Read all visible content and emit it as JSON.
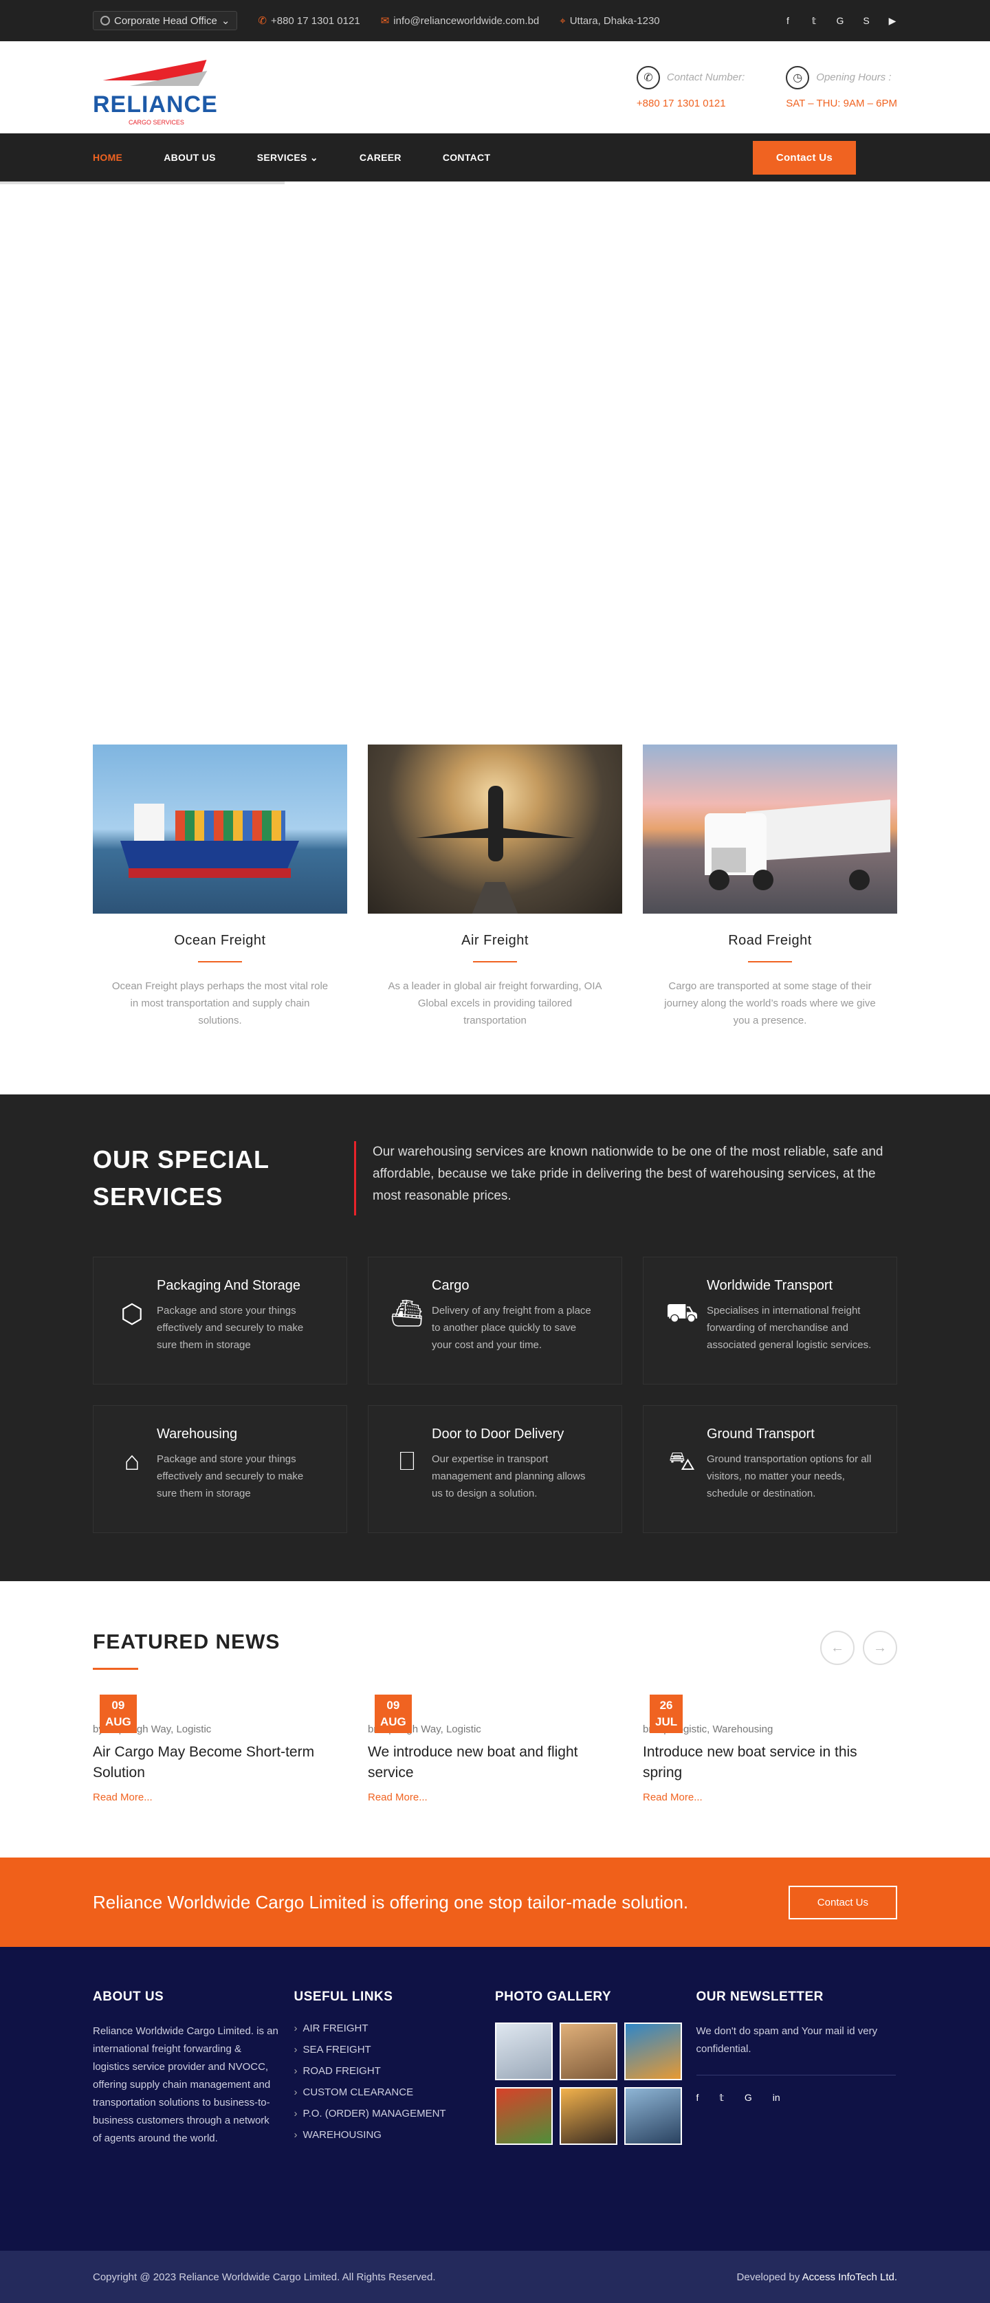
{
  "topbar": {
    "office": "Corporate Head Office",
    "phone": "+880 17 1301 0121",
    "email": "info@relianceworldwide.com.bd",
    "location": "Uttara, Dhaka-1230",
    "social_icons": [
      "facebook-icon",
      "twitter-icon",
      "google-plus-icon",
      "skype-icon",
      "youtube-icon"
    ]
  },
  "header": {
    "logo_text": "RELIANCE",
    "logo_sub": "CARGO SERVICES",
    "contact_label": "Contact Number:",
    "contact_value": "+880 17 1301 0121",
    "hours_label": "Opening Hours :",
    "hours_value": "SAT – THU: 9AM – 6PM"
  },
  "nav": {
    "items": [
      "HOME",
      "ABOUT US",
      "SERVICES",
      "CAREER",
      "CONTACT"
    ],
    "cta": "Contact Us"
  },
  "features": [
    {
      "title": "Ocean Freight",
      "text": "Ocean Freight plays perhaps the most vital role in most transportation and supply chain solutions."
    },
    {
      "title": "Air Freight",
      "text": "As a leader in global air freight forwarding, OIA Global excels in providing tailored transportation"
    },
    {
      "title": "Road Freight",
      "text": "Cargo are transported at some stage of their journey along the world’s roads where we give you a presence."
    }
  ],
  "special": {
    "title": "OUR SPECIAL SERVICES",
    "desc": "Our warehousing services are known nationwide to be one of the most reliable, safe and affordable, because we take pride in delivering the best of warehousing services, at the most reasonable prices.",
    "items": [
      {
        "title": "Packaging And Storage",
        "text": "Package and store your things effectively and securely to make sure them in storage"
      },
      {
        "title": "Cargo",
        "text": "Delivery of any freight from a place to another place quickly to save your cost and your time."
      },
      {
        "title": "Worldwide Transport",
        "text": "Specialises in international freight forwarding of merchandise and associated general logistic services."
      },
      {
        "title": "Warehousing",
        "text": "Package and store your things effectively and securely to make sure them in storage"
      },
      {
        "title": "Door to Door Delivery",
        "text": "Our expertise in transport management and planning allows us to design a solution."
      },
      {
        "title": "Ground Transport",
        "text": "Ground transportation options for all visitors, no matter your needs, schedule or destination."
      }
    ]
  },
  "news": {
    "title": "FEATURED NEWS",
    "items": [
      {
        "day": "09",
        "month": "AUG",
        "meta_by": "by",
        "meta_cat": "High Way, Logistic",
        "meta_author": "re",
        "title": "Air Cargo May Become Short-term Solution",
        "more": "Read More..."
      },
      {
        "day": "09",
        "month": "AUG",
        "meta_by": "b",
        "meta_cat": "High Way, Logistic",
        "meta_author": "re",
        "title": "We introduce new boat and flight service",
        "more": "Read More..."
      },
      {
        "day": "26",
        "month": "JUL",
        "meta_by": "b",
        "meta_cat": "Logistic, Warehousing",
        "meta_author": "re",
        "title": "Introduce new boat service in this spring",
        "more": "Read More..."
      }
    ]
  },
  "band": {
    "text": "Reliance Worldwide Cargo Limited is offering one stop tailor-made solution.",
    "button": "Contact Us"
  },
  "footer": {
    "about_title": "ABOUT US",
    "about_text": "Reliance Worldwide Cargo Limited. is an international freight forwarding & logistics service provider and NVOCC, offering supply chain management and transportation solutions to business-to-business customers through a network of agents around the world.",
    "links_title": "USEFUL LINKS",
    "links": [
      "AIR FREIGHT",
      "SEA FREIGHT",
      "ROAD FREIGHT",
      "CUSTOM CLEARANCE",
      "P.O. (ORDER) MANAGEMENT",
      "WAREHOUSING"
    ],
    "gallery_title": "PHOTO GALLERY",
    "newsletter_title": "OUR NEWSLETTER",
    "newsletter_text": "We don't do spam and Your mail id very confidential.",
    "copyright": "Copyright @ 2023 Reliance Worldwide Cargo Limited. All Rights Reserved.",
    "developed_prefix": "Developed by",
    "developer": "Access InfoTech Ltd."
  },
  "colors": {
    "accent": "#f06321",
    "dark": "#222222",
    "footer": "#0f1245"
  }
}
